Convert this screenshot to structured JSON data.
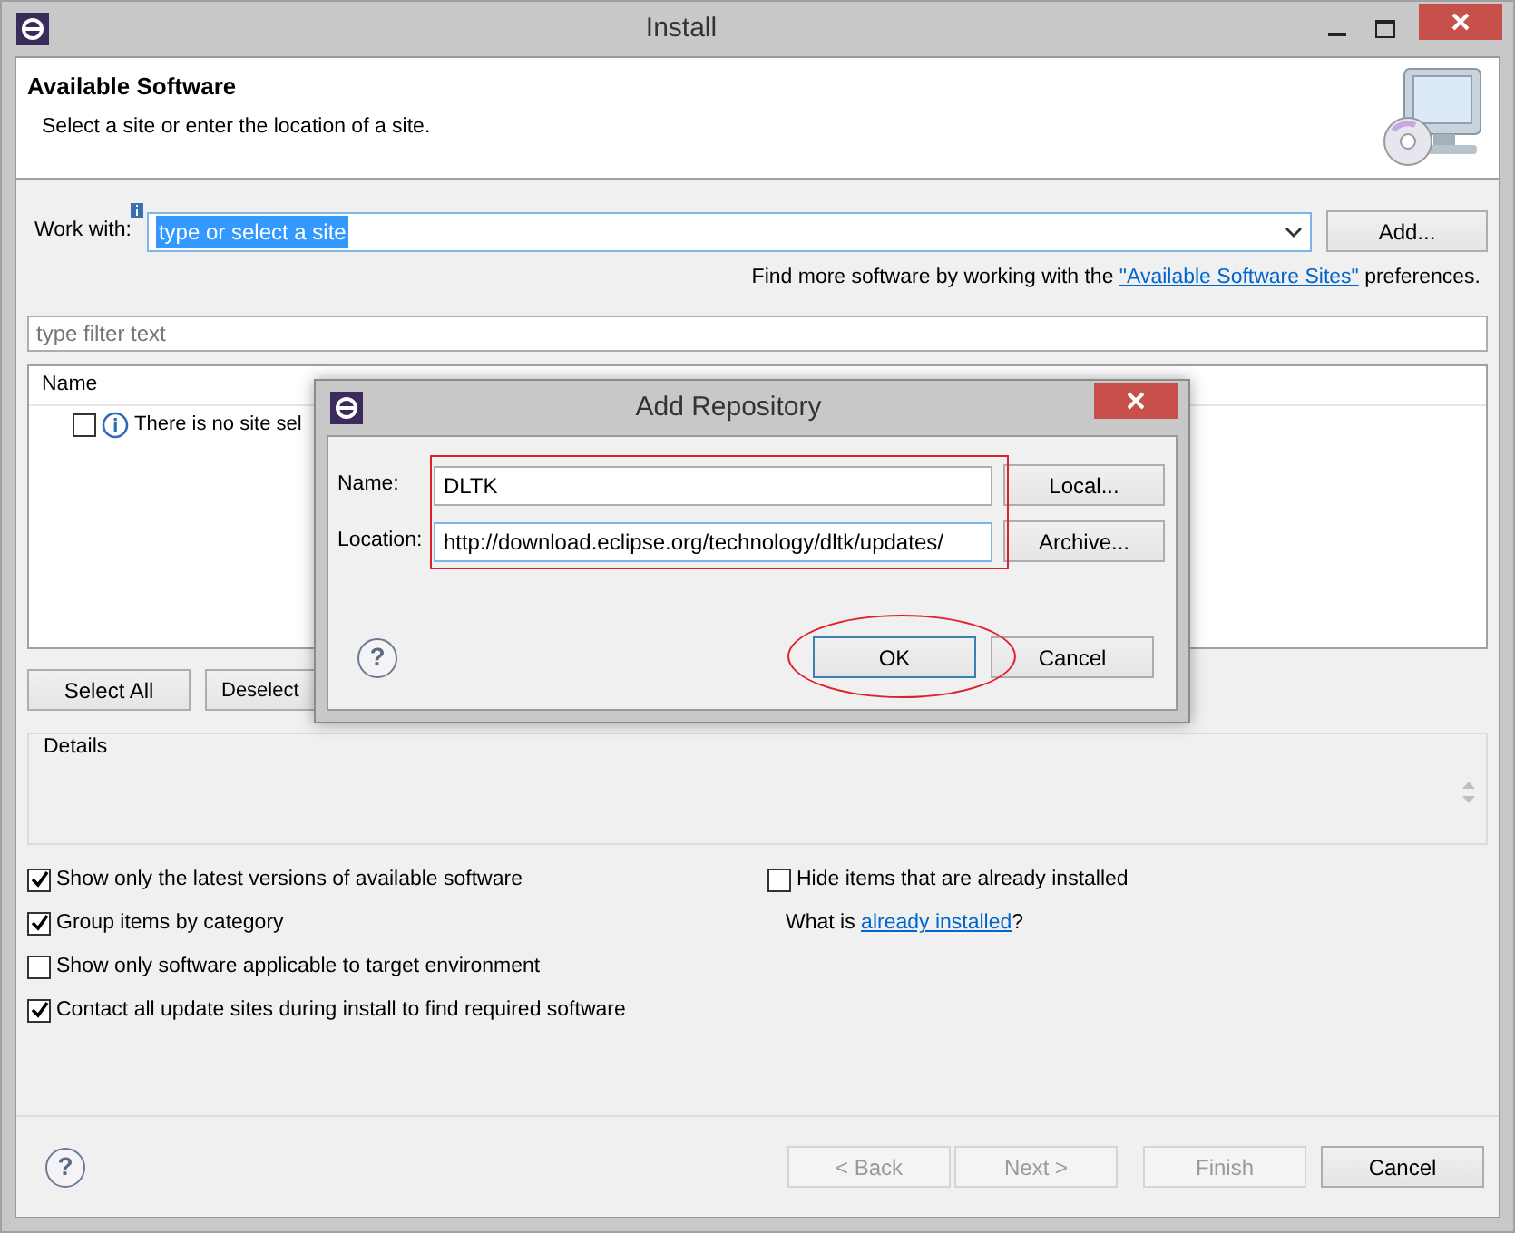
{
  "window": {
    "title": "Install"
  },
  "header": {
    "title": "Available Software",
    "subtitle": "Select a site or enter the location of a site."
  },
  "work_with": {
    "label": "Work with:",
    "value": "type or select a site",
    "add_button": "Add..."
  },
  "find_more": {
    "before": "Find more software by working with the",
    "link": "\"Available Software Sites\"",
    "after": "preferences."
  },
  "filter": {
    "placeholder": "type filter text"
  },
  "table": {
    "columns": [
      "Name"
    ],
    "rows": [
      {
        "text": "There is no site sel",
        "checked": false
      }
    ]
  },
  "list_buttons": [
    "Select All",
    "Deselect"
  ],
  "details": {
    "label": "Details"
  },
  "options": [
    {
      "label": "Show only the latest versions of available software",
      "checked": true
    },
    {
      "label": "Group items by category",
      "checked": true
    },
    {
      "label": "Show only software applicable to target environment",
      "checked": false
    },
    {
      "label": "Contact all update sites during install to find required software",
      "checked": true
    }
  ],
  "hide_installed": {
    "label": "Hide items that are already installed",
    "checked": false
  },
  "what_is": {
    "before": "What is",
    "link": "already installed",
    "after": "?"
  },
  "help_glyph": "?",
  "dialog_help_glyph": "?",
  "footer_buttons": [
    {
      "label": "< Back",
      "disabled": true
    },
    {
      "label": "Next >",
      "disabled": true
    },
    {
      "label": "Finish",
      "disabled": true
    },
    {
      "label": "Cancel",
      "disabled": false
    }
  ],
  "dialog": {
    "title": "Add Repository",
    "fields": [
      {
        "label": "Name:",
        "value": "DLTK",
        "button": "Local...",
        "focused": false
      },
      {
        "label": "Location:",
        "value": "http://download.eclipse.org/technology/dltk/updates/",
        "button": "Archive...",
        "focused": true
      }
    ],
    "buttons": [
      {
        "label": "OK",
        "default": true
      },
      {
        "label": "Cancel",
        "default": false
      }
    ]
  }
}
